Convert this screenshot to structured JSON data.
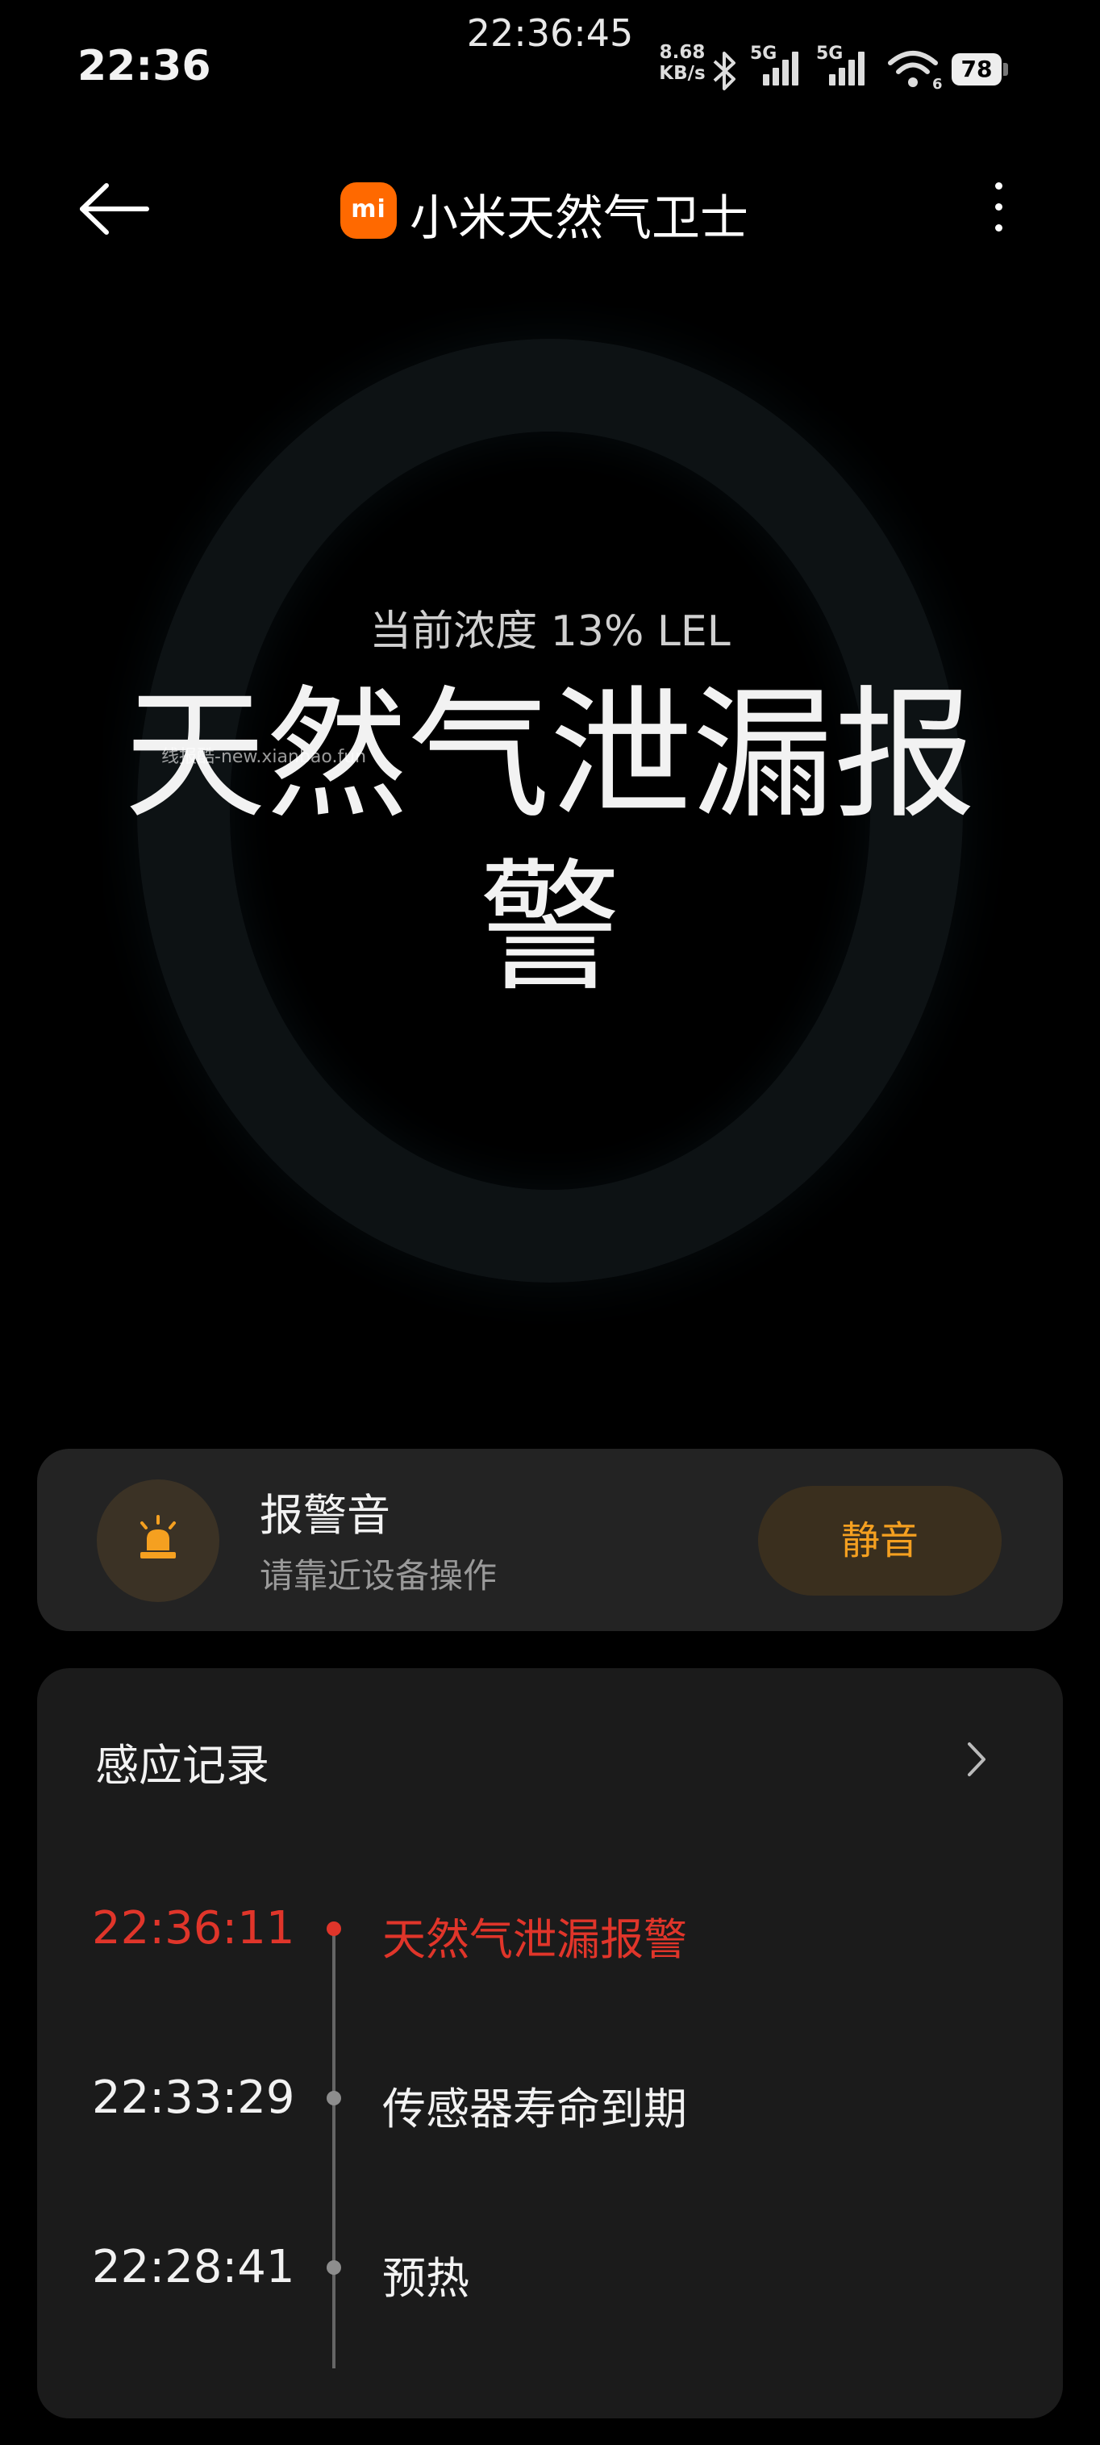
{
  "overlay": {
    "recording_clock": "22:36:45"
  },
  "status_bar": {
    "time": "22:36",
    "net_speed_value": "8.68",
    "net_speed_unit": "KB/s",
    "sim1_label": "5G",
    "sim2_label": "5G",
    "wifi_badge": "6",
    "battery": "78",
    "icons": [
      "bluetooth-icon",
      "signal-icon",
      "signal-icon",
      "wifi-icon",
      "battery-icon"
    ]
  },
  "header": {
    "logo_text": "mi",
    "title": "小米天然气卫士",
    "accent": "#ff6900"
  },
  "hero": {
    "concentration": "当前浓度 13% LEL",
    "status": "天然气泄漏报警",
    "watermark": "线报酷-new.xianbao.fun"
  },
  "alarm_sound": {
    "title": "报警音",
    "subtitle": "请靠近设备操作",
    "mute_label": "静音",
    "icon": "siren-icon",
    "accent": "#f5a020"
  },
  "records": {
    "title": "感应记录",
    "items": [
      {
        "time": "22:36:11",
        "event": "天然气泄漏报警",
        "alert": true
      },
      {
        "time": "22:33:29",
        "event": "传感器寿命到期",
        "alert": false
      },
      {
        "time": "22:28:41",
        "event": "预热",
        "alert": false
      }
    ],
    "alert_color": "#e0352a"
  }
}
